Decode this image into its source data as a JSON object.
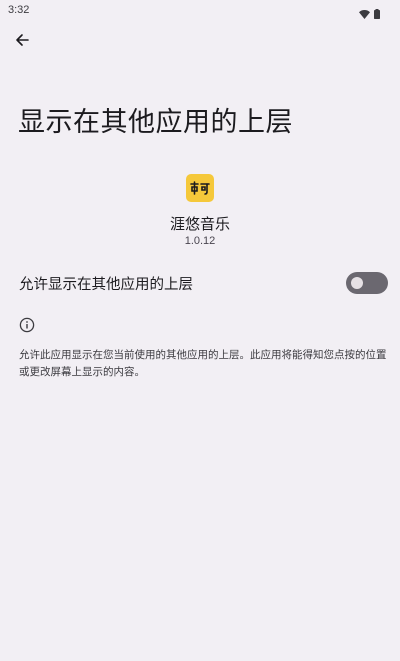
{
  "status_bar": {
    "time": "3:32",
    "icons": [
      "wifi-icon",
      "battery-icon"
    ]
  },
  "header": {
    "back_icon": "arrow-left-icon",
    "title": "显示在其他应用的上层"
  },
  "app": {
    "icon": "app-logo-icon",
    "icon_color": "#f5c83a",
    "name": "涯悠音乐",
    "version": "1.0.12"
  },
  "permission": {
    "label": "允许显示在其他应用的上层",
    "enabled": false
  },
  "info": {
    "icon": "info-icon",
    "description": "允许此应用显示在您当前使用的其他应用的上层。此应用将能得知您点按的位置或更改屏幕上显示的内容。"
  }
}
